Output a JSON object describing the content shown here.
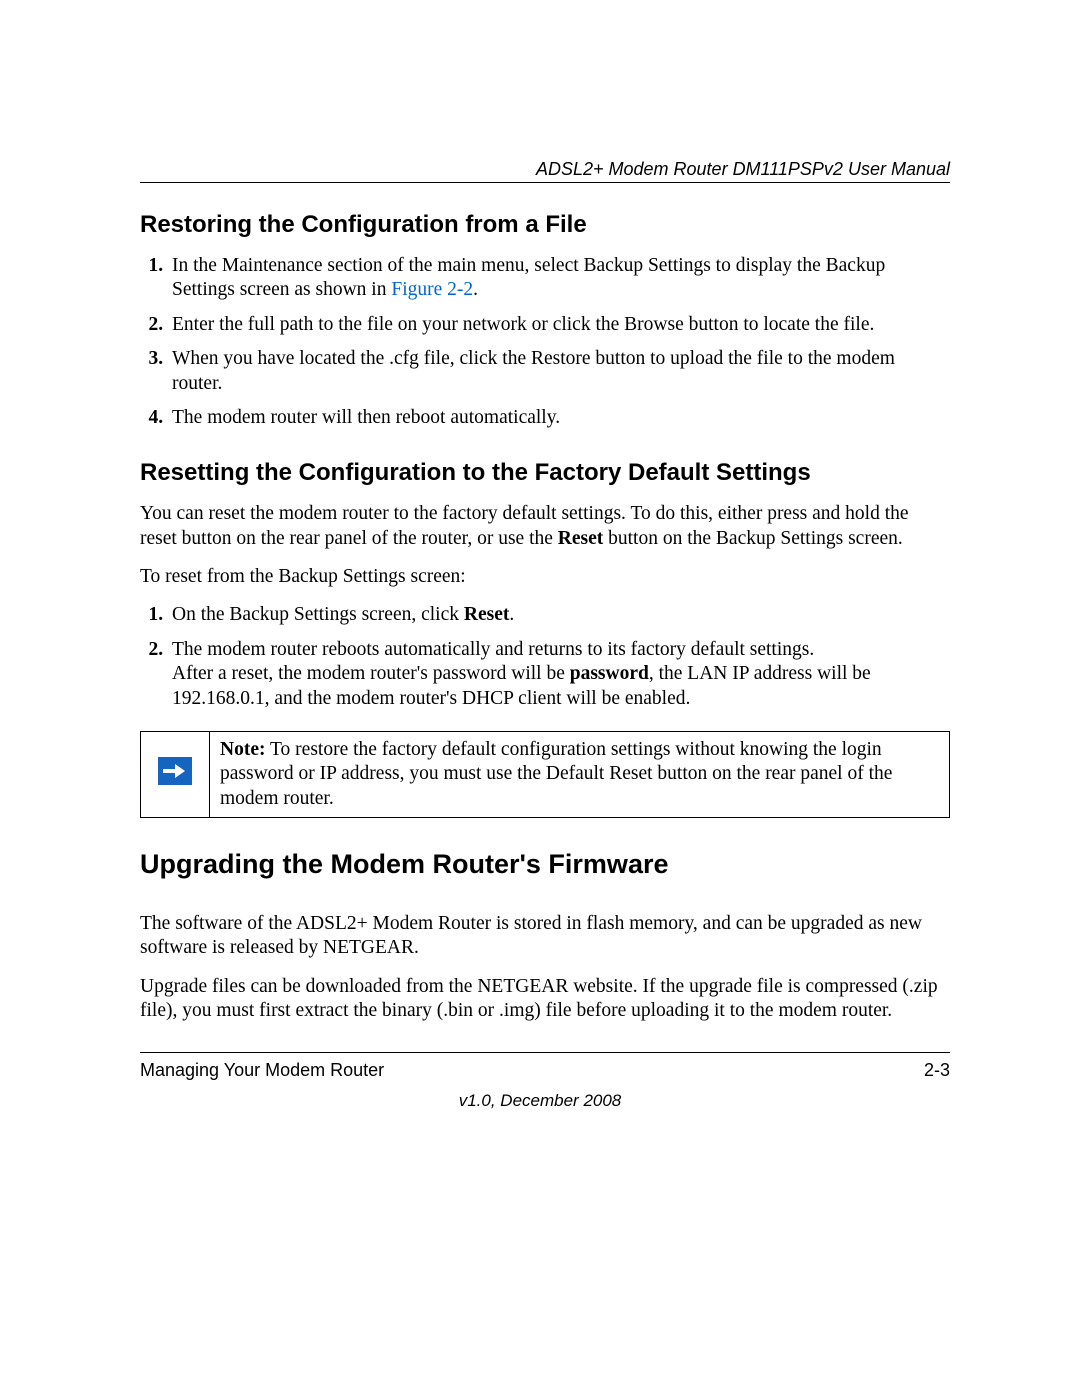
{
  "header": {
    "running_title": "ADSL2+ Modem Router DM111PSPv2 User Manual"
  },
  "section1": {
    "title": "Restoring the Configuration from a File",
    "steps": {
      "s1_pre": "In the Maintenance section of the main menu, select Backup Settings to display the Backup Settings screen as shown in ",
      "s1_link": "Figure 2-2",
      "s1_post": ".",
      "s2": "Enter the full path to the file on your network or click the Browse button to locate the file.",
      "s3": "When you have located the .cfg file, click the Restore button to upload the file to the modem router.",
      "s4": "The modem router will then reboot automatically."
    }
  },
  "section2": {
    "title": "Resetting the Configuration to the Factory Default Settings",
    "intro_pre": "You can reset the modem router to the factory default settings. To do this, either press and hold the reset button on the rear panel of the router, or use the ",
    "intro_bold": "Reset",
    "intro_post": " button on the Backup Settings screen.",
    "lead": "To reset from the Backup Settings screen:",
    "steps": {
      "s1_pre": "On the Backup Settings screen, click ",
      "s1_bold": "Reset",
      "s1_post": ".",
      "s2": "The modem router reboots automatically and returns to its factory default settings."
    },
    "after_pre": "After a reset, the modem router's password will be ",
    "after_bold": "password",
    "after_post": ", the LAN IP address will be 192.168.0.1, and the modem router's DHCP client will be enabled.",
    "note_label": "Note:",
    "note_text": " To restore the factory default configuration settings without knowing the login password or IP address, you must use the Default Reset button on the rear panel of the modem router."
  },
  "section3": {
    "title": "Upgrading the Modem Router's Firmware",
    "p1": "The software of the ADSL2+ Modem Router is stored in flash memory, and can be upgraded as new software is released by NETGEAR.",
    "p2": "Upgrade files can be downloaded from the NETGEAR website. If the upgrade file is compressed (.zip file), you must first extract the binary (.bin or .img) file before uploading it to the modem router."
  },
  "footer": {
    "section_name": "Managing Your Modem Router",
    "page_num": "2-3",
    "version": "v1.0, December 2008"
  }
}
